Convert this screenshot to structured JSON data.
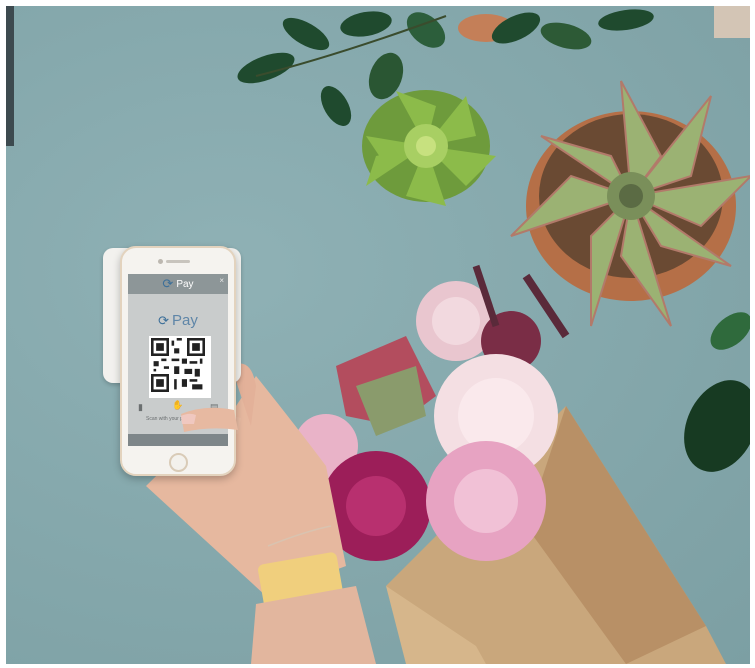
{
  "phone_screen": {
    "header_title": "Pay",
    "logo_text": "Pay",
    "close_symbol": "×",
    "scan_instruction": "Scan with your phone",
    "icons": [
      "wallet-icon",
      "hand-phone-icon",
      "receipt-icon"
    ]
  },
  "colors": {
    "background": "#86a9ad",
    "pay_brand": "#5f86a8",
    "paper_wrap": "#c9a77c"
  }
}
